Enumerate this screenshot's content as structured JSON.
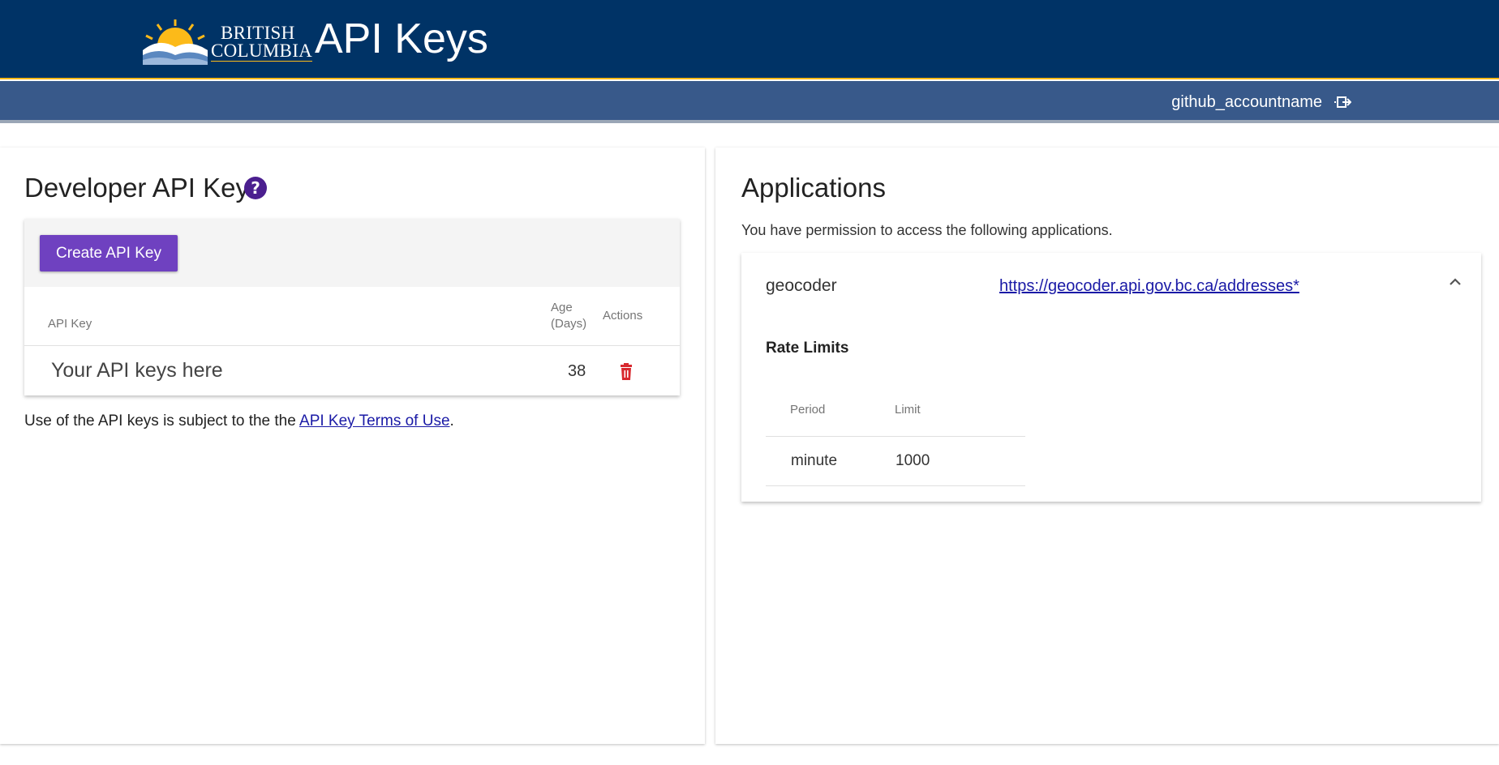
{
  "header": {
    "logo_line1": "BRITISH",
    "logo_line2": "COLUMBIA",
    "title": "API Keys"
  },
  "user": {
    "username": "github_accountname",
    "logout_icon": "logout-icon"
  },
  "developer": {
    "title": "Developer API Key",
    "help_icon": "question-circle-icon",
    "create_label": "Create API Key",
    "columns": {
      "key": "API Key",
      "age_line1": "Age",
      "age_line2": "(Days)",
      "actions": "Actions"
    },
    "rows": [
      {
        "key": "Your API keys here",
        "age": "38",
        "action_icon": "trash-icon"
      }
    ],
    "terms_prefix": "Use of the API keys is subject to the the ",
    "terms_link": "API Key Terms of Use",
    "terms_suffix": "."
  },
  "applications": {
    "title": "Applications",
    "permission_text": "You have permission to access the following applications.",
    "items": [
      {
        "name": "geocoder",
        "url": "https://geocoder.api.gov.bc.ca/addresses*",
        "expanded_icon": "chevron-up-icon",
        "rate_limits_title": "Rate Limits",
        "rate_columns": {
          "period": "Period",
          "limit": "Limit"
        },
        "rate_limits": [
          {
            "period": "minute",
            "limit": "1000"
          }
        ]
      }
    ]
  },
  "colors": {
    "header_bg": "#003366",
    "subheader_bg": "#38598a",
    "accent_gold": "#fcba19",
    "primary_button": "#6f41c0",
    "danger": "#d8292f",
    "link": "#1a1aa6"
  }
}
